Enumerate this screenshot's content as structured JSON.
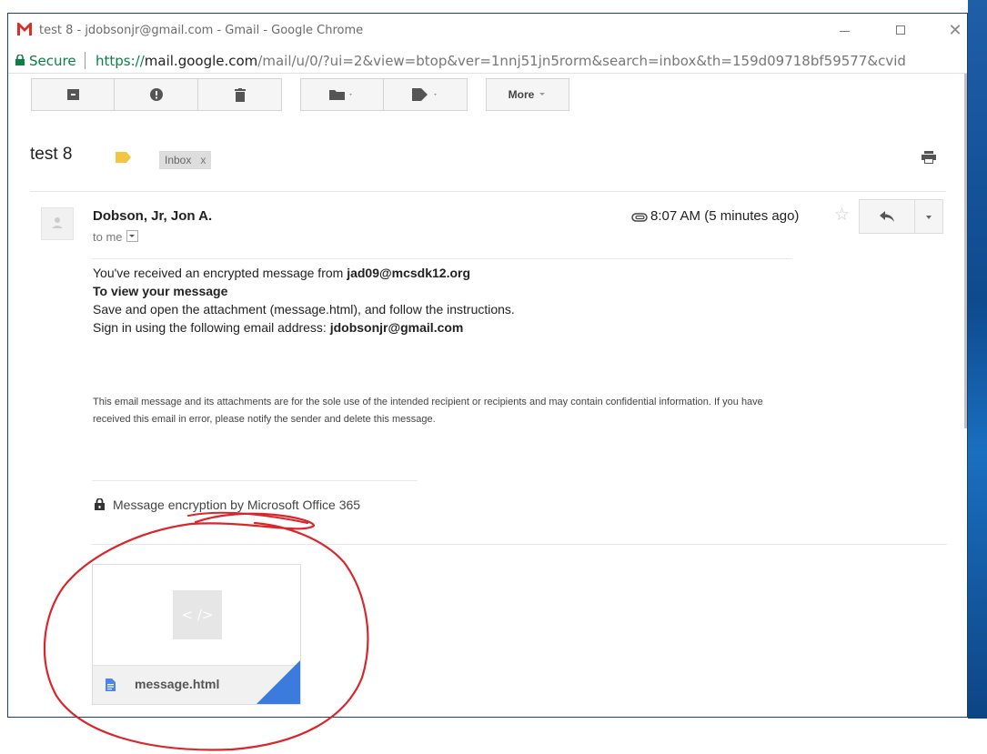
{
  "window": {
    "title": "test 8 - jdobsonjr@gmail.com - Gmail - Google Chrome",
    "close_glyph": "✕"
  },
  "address_bar": {
    "secure_label": "Secure",
    "url_scheme": "https://",
    "url_host": "mail.google.com",
    "url_path": "/mail/u/0/?ui=2&view=btop&ver=1nnj51jn5rorm&search=inbox&th=159d09718bf59577&cvid"
  },
  "toolbar": {
    "more_label": "More"
  },
  "email": {
    "subject": "test 8",
    "label_chip": "Inbox",
    "label_chip_close": "x",
    "sender": "Dobson, Jr, Jon A.",
    "recipient": "to me",
    "timestamp": "8:07 AM (5 minutes ago)",
    "body": {
      "line1_prefix": "You've received an encrypted message from ",
      "line1_email": "jad09@mcsdk12.org",
      "line2": "To view your message",
      "line3": "Save and open the attachment (message.html), and follow the instructions.",
      "line4_prefix": "Sign in using the following email address: ",
      "line4_email": "jdobsonjr@gmail.com"
    },
    "disclaimer": "This email message and its attachments are for the sole use of the intended recipient or recipients and may contain confidential information. If you have received this email in error, please notify the sender and delete this message.",
    "encryption_note": "Message encryption by Microsoft Office 365",
    "attachment": {
      "name": "message.html",
      "preview_glyph": "< />"
    }
  },
  "colors": {
    "secure_green": "#0b8043",
    "label_yellow": "#f4c542",
    "annotation_red": "#d9262b",
    "attachment_fold": "#3b7bde"
  }
}
